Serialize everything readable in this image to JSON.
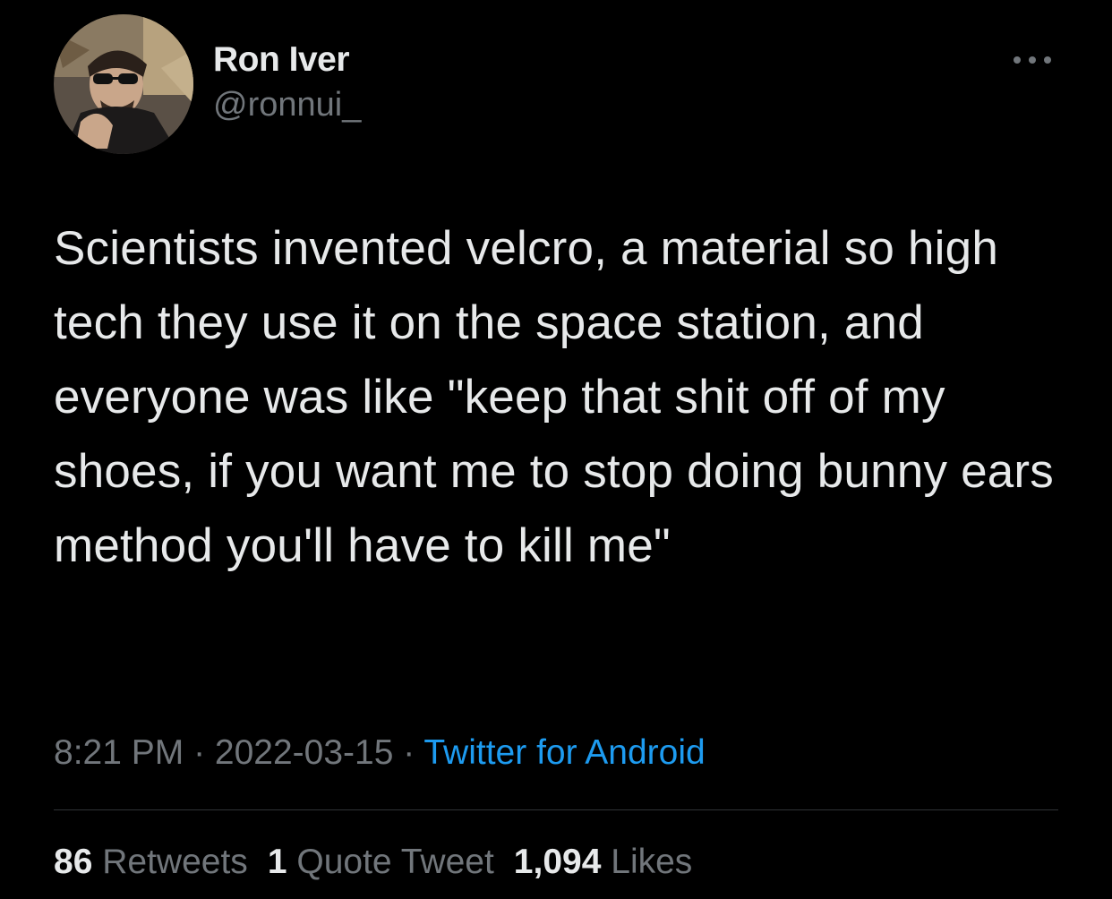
{
  "author": {
    "display_name": "Ron Iver",
    "handle": "@ronnui_",
    "avatar_icon": "profile-photo"
  },
  "more_icon": "more-horizontal-icon",
  "tweet_text": "Scientists invented velcro, a material so high tech they use it on the space station, and everyone was like \"keep that shit off of my shoes, if you want me to stop doing bunny ears method you'll have to kill me\"",
  "meta": {
    "time": "8:21 PM",
    "separator": " · ",
    "date": "2022-03-15",
    "source": "Twitter for Android"
  },
  "stats": {
    "retweets_count": "86",
    "retweets_label": "Retweets",
    "quotes_count": "1",
    "quotes_label": "Quote Tweet",
    "likes_count": "1,094",
    "likes_label": "Likes"
  },
  "colors": {
    "background": "#000000",
    "text": "#e7e9ea",
    "secondary": "#71767b",
    "link": "#1d9bf0",
    "divider": "#2f3336"
  }
}
